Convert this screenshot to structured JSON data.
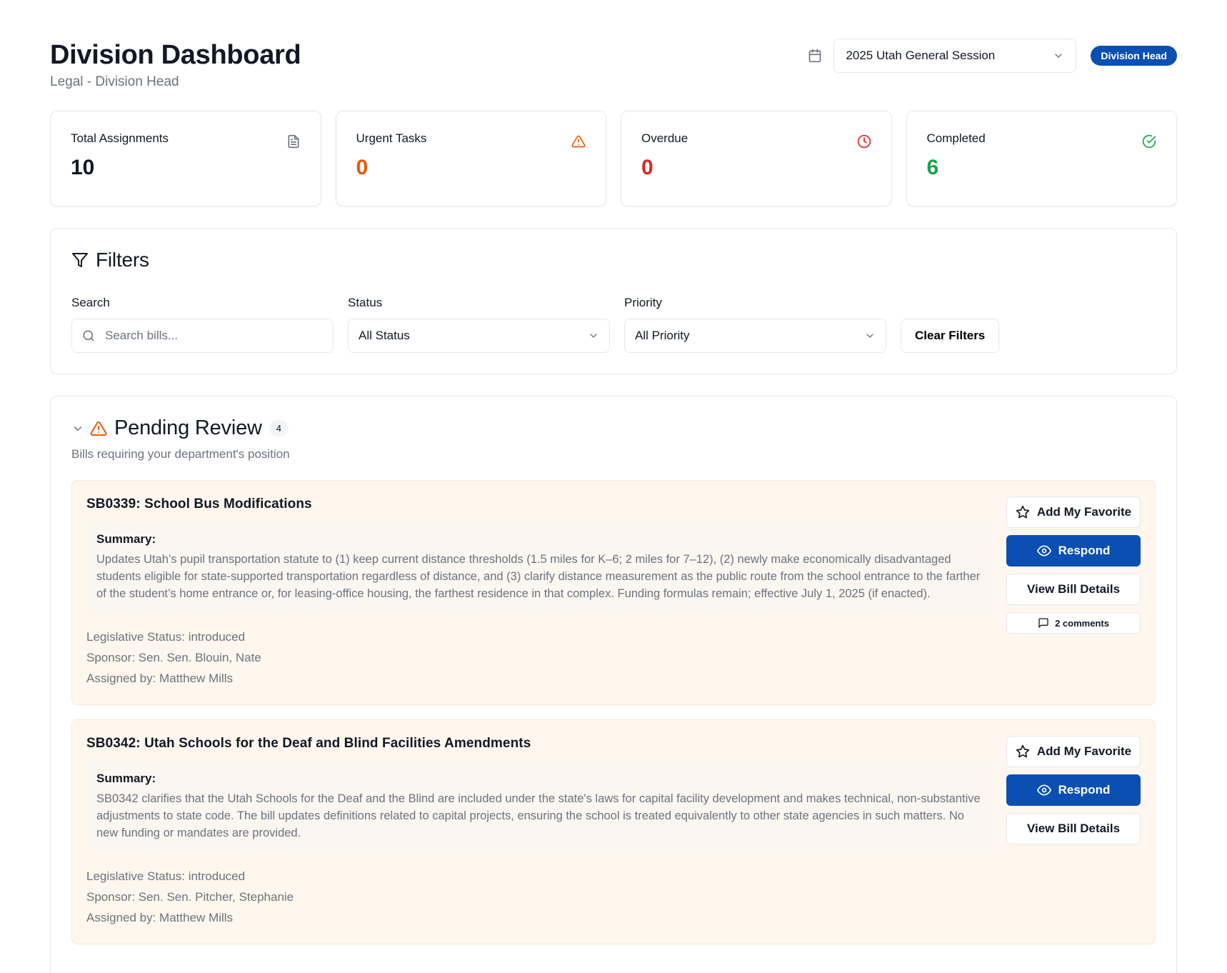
{
  "header": {
    "title": "Division Dashboard",
    "subtitle": "Legal - Division Head",
    "session_value": "2025 Utah General Session",
    "role_badge": "Division Head"
  },
  "stats": [
    {
      "label": "Total Assignments",
      "value": "10",
      "icon": "document-icon",
      "color": "#111827"
    },
    {
      "label": "Urgent Tasks",
      "value": "0",
      "icon": "warning-icon",
      "color": "#ea580c"
    },
    {
      "label": "Overdue",
      "value": "0",
      "icon": "clock-icon",
      "color": "#dc2626"
    },
    {
      "label": "Completed",
      "value": "6",
      "icon": "check-circle-icon",
      "color": "#16a34a"
    }
  ],
  "filters": {
    "title": "Filters",
    "search_label": "Search",
    "search_placeholder": "Search bills...",
    "status_label": "Status",
    "status_value": "All Status",
    "priority_label": "Priority",
    "priority_value": "All Priority",
    "clear_label": "Clear Filters"
  },
  "pending": {
    "title": "Pending Review",
    "count": "4",
    "subtitle": "Bills requiring your department's position",
    "bills": [
      {
        "title": "SB0339: School Bus Modifications",
        "summary_label": "Summary:",
        "summary": "Updates Utah’s pupil transportation statute to (1) keep current distance thresholds (1.5 miles for K–6; 2 miles for 7–12), (2) newly make economically disadvantaged students eligible for state-supported transportation regardless of distance, and (3) clarify distance measurement as the public route from the school entrance to the farther of the student’s home entrance or, for leasing-office housing, the farthest residence in that complex. Funding formulas remain; effective July 1, 2025 (if enacted).",
        "status": "Legislative Status: introduced",
        "sponsor": "Sponsor: Sen. Sen. Blouin, Nate",
        "assigned": "Assigned by: Matthew Mills",
        "favorite_label": "Add My Favorite",
        "respond_label": "Respond",
        "details_label": "View Bill Details",
        "comments_label": "2 comments"
      },
      {
        "title": "SB0342: Utah Schools for the Deaf and Blind Facilities Amendments",
        "summary_label": "Summary:",
        "summary": "SB0342 clarifies that the Utah Schools for the Deaf and the Blind are included under the state's laws for capital facility development and makes technical, non-substantive adjustments to state code. The bill updates definitions related to capital projects, ensuring the school is treated equivalently to other state agencies in such matters. No new funding or mandates are provided.",
        "status": "Legislative Status: introduced",
        "sponsor": "Sponsor: Sen. Sen. Pitcher, Stephanie",
        "assigned": "Assigned by: Matthew Mills",
        "favorite_label": "Add My Favorite",
        "respond_label": "Respond",
        "details_label": "View Bill Details"
      }
    ]
  },
  "colors": {
    "primary": "#0b4fb3",
    "warning": "#ea580c",
    "danger": "#dc2626",
    "success": "#16a34a",
    "bill_bg": "#fff7ed"
  }
}
